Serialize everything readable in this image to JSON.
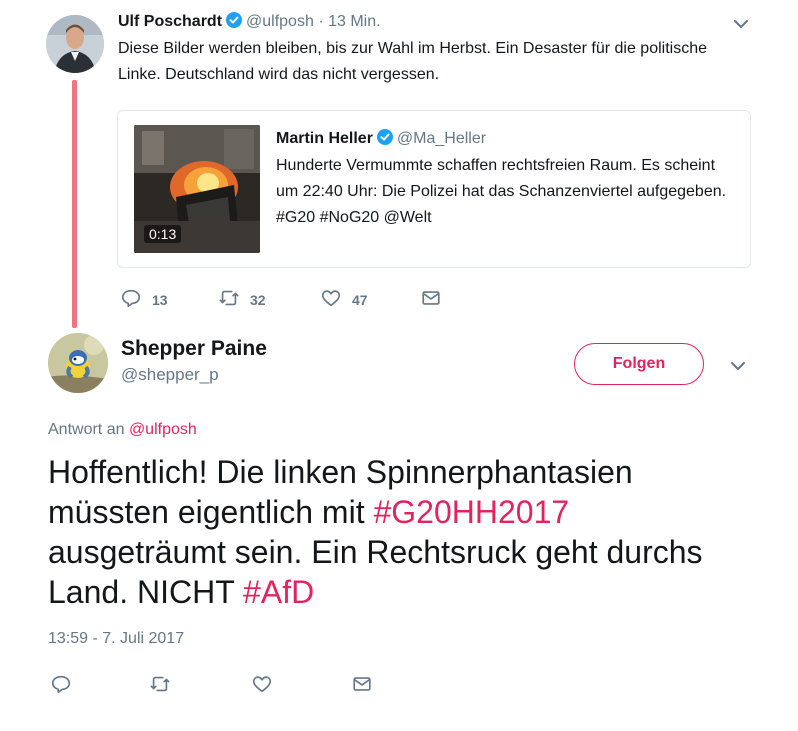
{
  "tweet1": {
    "author_name": "Ulf Poschardt",
    "author_handle": "@ulfposh",
    "time_sep": "·",
    "time": "13 Min.",
    "text": "Diese Bilder werden bleiben, bis zur Wahl im Herbst. Ein Desaster für die politische Linke. Deutschland wird das nicht vergessen.",
    "quote": {
      "author_name": "Martin Heller",
      "author_handle": "@Ma_Heller",
      "text": "Hunderte Vermummte schaffen rechtsfreien Raum. Es scheint um 22:40 Uhr: Die Polizei hat das Schanzenviertel aufgegeben. #G20 #NoG20 @Welt",
      "video_duration": "0:13"
    },
    "actions": {
      "reply_count": "13",
      "retweet_count": "32",
      "like_count": "47"
    }
  },
  "tweet2": {
    "author_name": "Shepper Paine",
    "author_handle": "@shepper_p",
    "follow_label": "Folgen",
    "reply_prefix": "Antwort an",
    "reply_to": "@ulfposh",
    "text_part1": "Hoffentlich! Die linken Spinnerphantasien müssten eigentlich mit ",
    "hashtag1": "#G20HH2017",
    "text_part2": " ausgeträumt sein. Ein Rechtsruck geht durchs Land. NICHT ",
    "hashtag2": "#AfD",
    "timestamp": "13:59 - 7. Juli 2017"
  },
  "colors": {
    "accent": "#e0245e",
    "thread_line": "#f0747d",
    "muted": "#657786",
    "verified": "#1da1f2",
    "border": "#e1e8ed"
  },
  "icons": [
    "chevron-down-icon",
    "verified-icon",
    "reply-icon",
    "retweet-icon",
    "like-icon",
    "message-icon"
  ]
}
